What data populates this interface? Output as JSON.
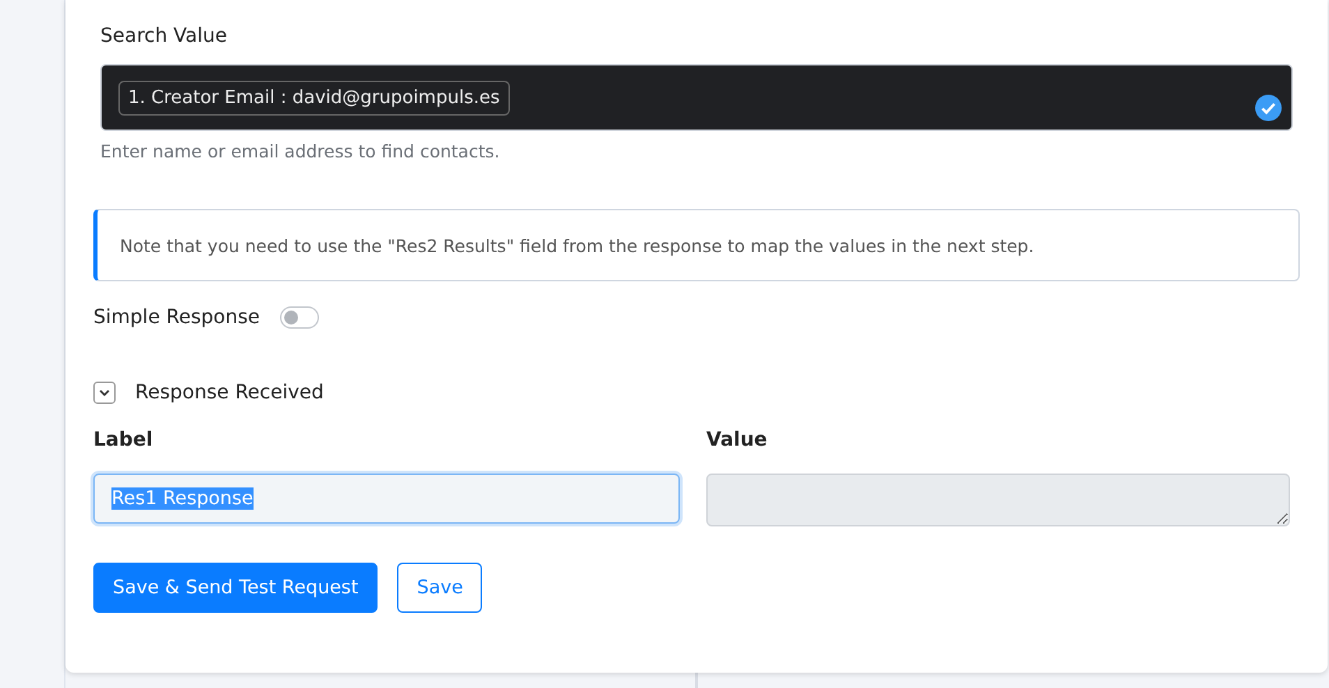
{
  "search_value": {
    "label": "Search Value",
    "tags": [
      "1. Creator Email : david@grupoimpuls.es"
    ],
    "valid": true,
    "help": "Enter name or email address to find contacts."
  },
  "note": "Note that you need to use the \"Res2 Results\" field from the response to map the values in the next step.",
  "simple_response": {
    "label": "Simple Response",
    "on": false
  },
  "response_received": {
    "label": "Response Received",
    "expanded": true
  },
  "columns": [
    "Label",
    "Value"
  ],
  "rows": [
    {
      "label": "Res1 Response",
      "label_highlighted": true,
      "value_disabled": true
    }
  ],
  "buttons": [
    {
      "label": "Save & Send Test Request",
      "kind": "primary"
    },
    {
      "label": "Save",
      "kind": "outline"
    }
  ]
}
